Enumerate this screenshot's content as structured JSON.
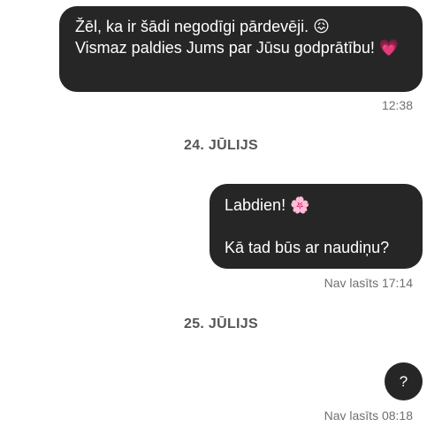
{
  "messages": [
    {
      "id": "m1",
      "text": "Žēl, ka ir šādi negodīgi pārdevēji. 😖\nVismaz paldies Jums par Jūsu godprātību! 💗",
      "time": "12:38",
      "status": ""
    },
    {
      "id": "m2",
      "text": "Labdien! 🌸\n\nKā tad būs ar naudiņu?",
      "time": "17:14",
      "status": "Nav lasīts"
    },
    {
      "id": "m3",
      "text": "?",
      "time": "08:18",
      "status": "Nav lasīts"
    }
  ],
  "dates": {
    "d1": "24. JŪLIJS",
    "d2": "25. JŪLIJS"
  },
  "meta": {
    "m1": "12:38",
    "m2": "Nav lasīts 17:14",
    "m3": "Nav lasīts 08:18"
  },
  "colors": {
    "bubble": "#262626",
    "bubble_text": "#ffffff",
    "meta_text": "#6f6f6f",
    "date_text": "#555555"
  }
}
